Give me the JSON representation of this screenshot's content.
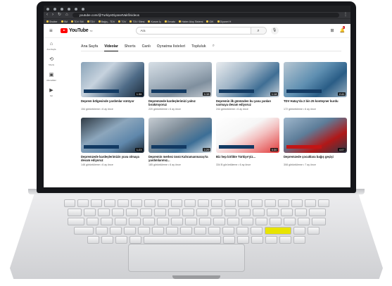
{
  "browser": {
    "url": "youtube.com/@TurkiyeDiyanetVakfi/videos",
    "bookmarks": [
      "Shutter",
      "SM",
      "TDV SM",
      "TDV",
      "Bağış - TDV",
      "TDV",
      "TDV Sitesi",
      "Kurum İç",
      "Envato",
      "Haber Akış Sistemi",
      "GIK",
      "Diyanet H"
    ]
  },
  "youtube": {
    "logo_text": "YouTube",
    "logo_country": "TR",
    "search_query": "Ara",
    "notification_count": "9"
  },
  "sidebar": [
    {
      "label": "Ana Sayfa",
      "icon": "home-icon",
      "glyph": "⌂"
    },
    {
      "label": "Shorts",
      "icon": "shorts-icon",
      "glyph": "⟲"
    },
    {
      "label": "Abonelikler",
      "icon": "subscriptions-icon",
      "glyph": "▣"
    },
    {
      "label": "Siz",
      "icon": "library-icon",
      "glyph": "▶"
    }
  ],
  "tabs": [
    "Ana Sayfa",
    "Videolar",
    "Shorts",
    "Canlı",
    "Oynatma listeleri",
    "Topluluk"
  ],
  "active_tab": "Videolar",
  "videos": [
    {
      "title": "Deprem bölgesinde yardımlar sürüyor",
      "meta": "154 görüntüleme • 6 ay önce",
      "duration": "1:36"
    },
    {
      "title": "Depremzede kardeşlerimizi yalnız bırakmıyoruz",
      "meta": "220 görüntüleme • 6 ay önce",
      "duration": "1:15"
    },
    {
      "title": "Depremin ilk gününden bu yana yanları sarmaya devam ediyoruz",
      "meta": "244 görüntüleme • 6 ay önce",
      "duration": "1:18"
    },
    {
      "title": "TDV Hatay'da 2 bin 25 konteyner kurdu",
      "meta": "172 görüntüleme • 6 ay önce",
      "duration": "2:41"
    },
    {
      "title": "Depremzede kardeşlerimizin yuva olmaya devam ediyoruz",
      "meta": "146 görüntüleme • 6 ay önce",
      "duration": "1:23"
    },
    {
      "title": "Depremin merkez üssü Kahramanmaraş'ta yardımlarımız...",
      "meta": "185 görüntüleme • 6 ay önce",
      "duration": "1:29"
    },
    {
      "title": "Biz hep birlikte Türkiye'yiz...",
      "meta": "334 B görüntüleme • 6 ay önce",
      "duration": "0:30"
    },
    {
      "title": "Depremzede çocuklara bağış geçişi",
      "meta": "308 görüntüleme • 7 ay önce",
      "duration": "4:07"
    }
  ],
  "colors": {
    "youtube_red": "#ff0000",
    "chrome_dark": "#202124",
    "keyboard_highlight": "#e8e400"
  }
}
